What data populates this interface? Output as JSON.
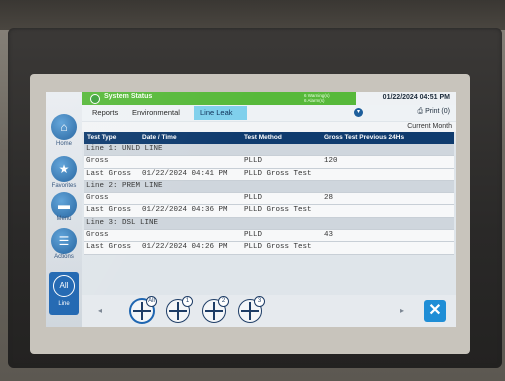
{
  "header": {
    "status_title": "System Status",
    "warnings": "6 Warning(s)",
    "alarms": "6 Alarm(s)",
    "datetime": "01/22/2024 04:51 PM"
  },
  "breadcrumb": {
    "reports": "Reports",
    "environmental": "Environmental",
    "line_leak": "Line Leak"
  },
  "toolbar": {
    "print_label": "Print (0)"
  },
  "period": "Current Month",
  "nav": {
    "home": "Home",
    "favorites": "Favorites",
    "menu": "Menu",
    "actions": "Actions",
    "all": "All",
    "line": "Line"
  },
  "table": {
    "columns": [
      "Test Type",
      "Date / Time",
      "Test Method",
      "Gross Test Previous 24Hs"
    ],
    "groups": [
      {
        "title": "Line 1: UNLD LINE",
        "gross": {
          "type": "Gross",
          "method": "PLLD",
          "value": "120"
        },
        "last": {
          "label": "Last Gross",
          "datetime": "01/22/2024 04:41 PM",
          "method": "PLLD Gross Test"
        }
      },
      {
        "title": "Line 2: PREM LINE",
        "gross": {
          "type": "Gross",
          "method": "PLLD",
          "value": "28"
        },
        "last": {
          "label": "Last Gross",
          "datetime": "01/22/2024 04:36 PM",
          "method": "PLLD Gross Test"
        }
      },
      {
        "title": "Line 3: DSL LINE",
        "gross": {
          "type": "Gross",
          "method": "PLLD",
          "value": "43"
        },
        "last": {
          "label": "Last Gross",
          "datetime": "01/22/2024 04:26 PM",
          "method": "PLLD Gross Test"
        }
      }
    ]
  },
  "line_selector": {
    "items": [
      {
        "badge": "All"
      },
      {
        "badge": "1"
      },
      {
        "badge": "2"
      },
      {
        "badge": "3"
      }
    ]
  },
  "icons": {
    "home": "home-icon",
    "favorites": "star-icon",
    "menu": "menu-icon",
    "actions": "actions-icon",
    "close": "close-icon",
    "print": "printer-icon"
  },
  "colors": {
    "status_bar": "#57b93a",
    "table_header": "#0f3b6e",
    "accent": "#1f66b1",
    "close_button": "#1f8ed6"
  }
}
